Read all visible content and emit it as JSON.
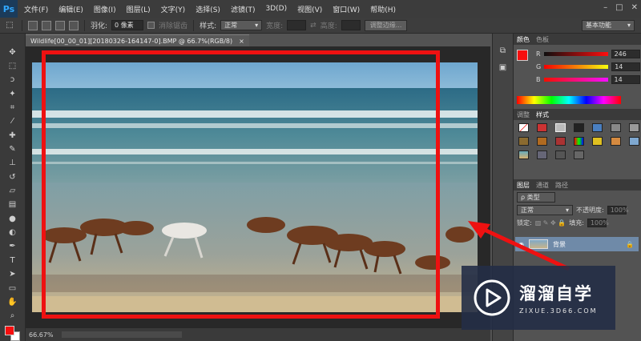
{
  "app": {
    "logo": "Ps"
  },
  "menu": [
    "文件(F)",
    "编辑(E)",
    "图像(I)",
    "图层(L)",
    "文字(Y)",
    "选择(S)",
    "滤镜(T)",
    "3D(D)",
    "视图(V)",
    "窗口(W)",
    "帮助(H)"
  ],
  "window_controls": {
    "min": "–",
    "max": "□",
    "close": "✕"
  },
  "options": {
    "feather_label": "羽化:",
    "feather_value": "0 像素",
    "antialias_label": "消除锯齿",
    "style_label": "样式:",
    "style_value": "正常",
    "width_label": "宽度:",
    "height_label": "高度:",
    "refine_button": "调整边缘...",
    "workspace": "基本功能"
  },
  "document": {
    "tab_title": "Wildlife[00_00_01][20180326-164147-0].BMP @ 66.7%(RGB/8)",
    "close": "×",
    "zoom": "66.67%"
  },
  "panels": {
    "color_tabs": [
      "颜色",
      "色板"
    ],
    "channels": [
      {
        "label": "R",
        "value": "246",
        "color": "#ee1111"
      },
      {
        "label": "G",
        "value": "14",
        "color": "#e0c000"
      },
      {
        "label": "B",
        "value": "14",
        "color": "#c030c0"
      }
    ],
    "styles_tabs": [
      "调整",
      "样式"
    ],
    "layers_tabs": [
      "图层",
      "通道",
      "路径"
    ],
    "kind_label": "ρ 类型",
    "blend_mode": "正常",
    "opacity_label": "不透明度:",
    "opacity_value": "100%",
    "lock_label": "锁定:",
    "fill_label": "填充:",
    "fill_value": "100%",
    "layer_name": "背景"
  },
  "watermark": {
    "title": "溜溜自学",
    "url": "ZIXUE.3D66.COM"
  },
  "colors": {
    "foreground": "#f60e0e",
    "background": "#ffffff",
    "annotation": "#ee1111"
  }
}
